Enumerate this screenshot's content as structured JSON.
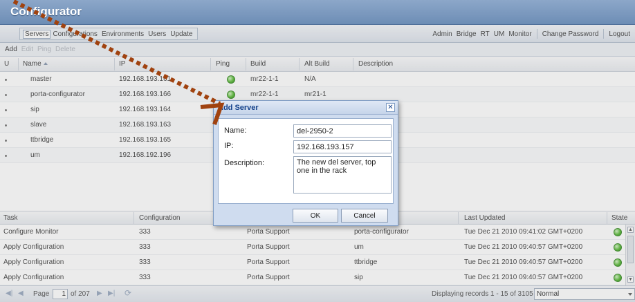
{
  "app": {
    "title": "Configurator"
  },
  "menu": {
    "left": [
      "Servers",
      "Configurations",
      "Environments",
      "Users",
      "Update"
    ],
    "right_a": [
      "Admin",
      "Bridge",
      "RT",
      "UM",
      "Monitor"
    ],
    "change_password": "Change Password",
    "logout": "Logout"
  },
  "toolbar": {
    "add": "Add",
    "edit": "Edit",
    "ping": "Ping",
    "delete": "Delete"
  },
  "servers": {
    "columns": {
      "u": "U",
      "name": "Name",
      "ip": "IP",
      "ping": "Ping",
      "build": "Build",
      "alt_build": "Alt Build",
      "description": "Description"
    },
    "rows": [
      {
        "name": "master",
        "ip": "192.168.193.161",
        "ping": true,
        "build": "mr22-1-1",
        "alt_build": "N/A"
      },
      {
        "name": "porta-configurator",
        "ip": "192.168.193.166",
        "ping": true,
        "build": "mr22-1-1",
        "alt_build": "mr21-1"
      },
      {
        "name": "sip",
        "ip": "192.168.193.164",
        "ping": false,
        "build": "",
        "alt_build": ""
      },
      {
        "name": "slave",
        "ip": "192.168.193.163",
        "ping": false,
        "build": "",
        "alt_build": ""
      },
      {
        "name": "ttbridge",
        "ip": "192.168.193.165",
        "ping": false,
        "build": "",
        "alt_build": ""
      },
      {
        "name": "um",
        "ip": "192.168.192.196",
        "ping": false,
        "build": "",
        "alt_build": ""
      }
    ]
  },
  "tasks": {
    "columns": {
      "task": "Task",
      "configuration": "Configuration",
      "last_updated": "Last Updated",
      "state": "State"
    },
    "rows": [
      {
        "task": "Configure Monitor",
        "configuration": "333",
        "user": "Porta Support",
        "server": "porta-configurator",
        "last_updated": "Tue Dec 21 2010 09:41:02 GMT+0200"
      },
      {
        "task": "Apply Configuration",
        "configuration": "333",
        "user": "Porta Support",
        "server": "um",
        "last_updated": "Tue Dec 21 2010 09:40:57 GMT+0200"
      },
      {
        "task": "Apply Configuration",
        "configuration": "333",
        "user": "Porta Support",
        "server": "ttbridge",
        "last_updated": "Tue Dec 21 2010 09:40:57 GMT+0200"
      },
      {
        "task": "Apply Configuration",
        "configuration": "333",
        "user": "Porta Support",
        "server": "sip",
        "last_updated": "Tue Dec 21 2010 09:40:57 GMT+0200"
      }
    ]
  },
  "paging": {
    "page_label": "Page",
    "page_value": "1",
    "of_label": "of 207",
    "display_text": "Displaying records 1 - 15 of 3105",
    "mode_value": "Normal"
  },
  "dialog": {
    "title": "Add Server",
    "name_label": "Name:",
    "name_value": "del-2950-2",
    "ip_label": "IP:",
    "ip_value": "192.168.193.157",
    "description_label": "Description:",
    "description_value": "The new del server, top one in the rack",
    "ok_label": "OK",
    "cancel_label": "Cancel"
  },
  "colors": {
    "accent": "#15428b",
    "titlebar": "#7b98bf",
    "annotation_arrow": "#a0420f",
    "ping_ok": "#5cbb3a"
  }
}
